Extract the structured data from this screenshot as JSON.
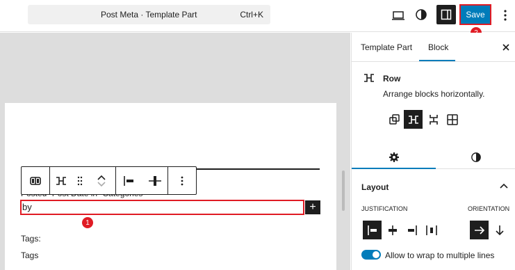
{
  "header": {
    "command_title": "Post Meta · Template Part",
    "command_shortcut": "Ctrl+K",
    "save_label": "Save",
    "badge_save": "2"
  },
  "canvas": {
    "post_text": "Posted· Post Date in· Categories",
    "selected_text": "by",
    "badge_selected": "1",
    "tags_label": "Tags:",
    "tags_value": "Tags",
    "plus_label": "+"
  },
  "sidebar": {
    "tabs": [
      "Template Part",
      "Block"
    ],
    "block_name": "Row",
    "block_desc": "Arrange blocks horizontally.",
    "layout_title": "Layout",
    "justification_label": "JUSTIFICATION",
    "orientation_label": "ORIENTATION",
    "wrap_label": "Allow to wrap to multiple lines"
  },
  "colors": {
    "accent": "#007cba",
    "highlight": "#e01b24",
    "dark": "#1e1e1e"
  }
}
